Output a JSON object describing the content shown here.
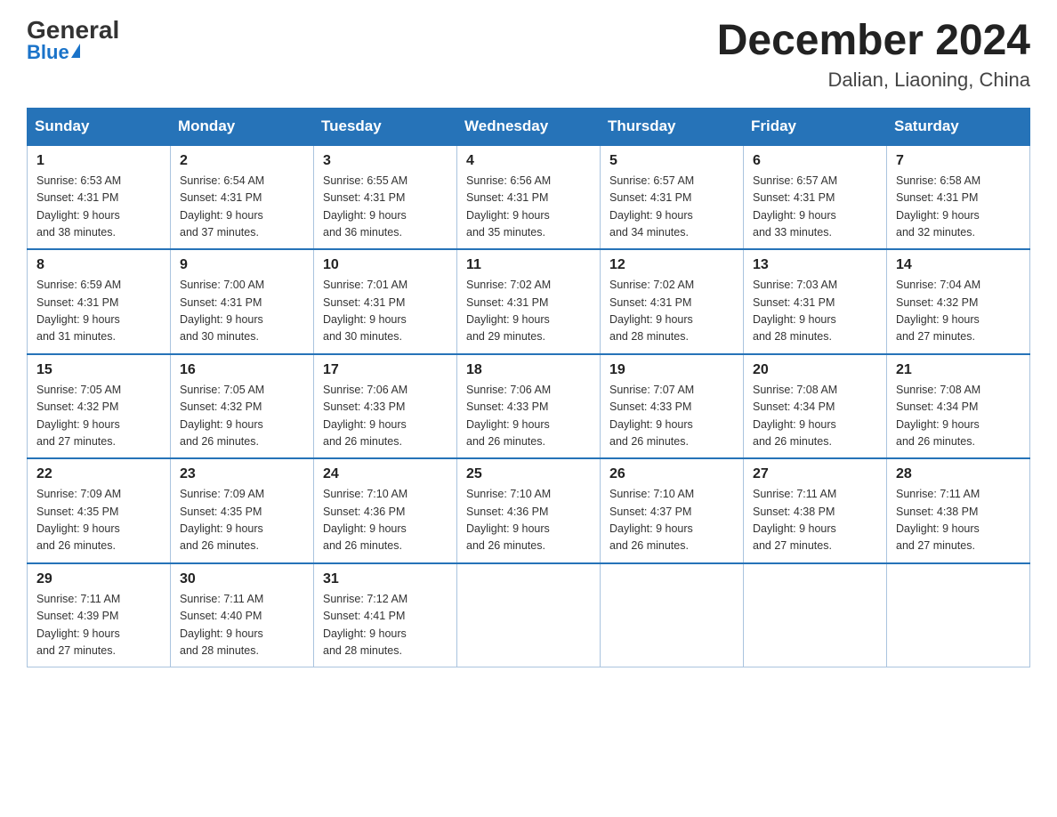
{
  "header": {
    "logo_general": "General",
    "logo_blue": "Blue",
    "month_title": "December 2024",
    "subtitle": "Dalian, Liaoning, China"
  },
  "weekdays": [
    "Sunday",
    "Monday",
    "Tuesday",
    "Wednesday",
    "Thursday",
    "Friday",
    "Saturday"
  ],
  "weeks": [
    [
      {
        "day": "1",
        "sunrise": "6:53 AM",
        "sunset": "4:31 PM",
        "daylight": "9 hours and 38 minutes."
      },
      {
        "day": "2",
        "sunrise": "6:54 AM",
        "sunset": "4:31 PM",
        "daylight": "9 hours and 37 minutes."
      },
      {
        "day": "3",
        "sunrise": "6:55 AM",
        "sunset": "4:31 PM",
        "daylight": "9 hours and 36 minutes."
      },
      {
        "day": "4",
        "sunrise": "6:56 AM",
        "sunset": "4:31 PM",
        "daylight": "9 hours and 35 minutes."
      },
      {
        "day": "5",
        "sunrise": "6:57 AM",
        "sunset": "4:31 PM",
        "daylight": "9 hours and 34 minutes."
      },
      {
        "day": "6",
        "sunrise": "6:57 AM",
        "sunset": "4:31 PM",
        "daylight": "9 hours and 33 minutes."
      },
      {
        "day": "7",
        "sunrise": "6:58 AM",
        "sunset": "4:31 PM",
        "daylight": "9 hours and 32 minutes."
      }
    ],
    [
      {
        "day": "8",
        "sunrise": "6:59 AM",
        "sunset": "4:31 PM",
        "daylight": "9 hours and 31 minutes."
      },
      {
        "day": "9",
        "sunrise": "7:00 AM",
        "sunset": "4:31 PM",
        "daylight": "9 hours and 30 minutes."
      },
      {
        "day": "10",
        "sunrise": "7:01 AM",
        "sunset": "4:31 PM",
        "daylight": "9 hours and 30 minutes."
      },
      {
        "day": "11",
        "sunrise": "7:02 AM",
        "sunset": "4:31 PM",
        "daylight": "9 hours and 29 minutes."
      },
      {
        "day": "12",
        "sunrise": "7:02 AM",
        "sunset": "4:31 PM",
        "daylight": "9 hours and 28 minutes."
      },
      {
        "day": "13",
        "sunrise": "7:03 AM",
        "sunset": "4:31 PM",
        "daylight": "9 hours and 28 minutes."
      },
      {
        "day": "14",
        "sunrise": "7:04 AM",
        "sunset": "4:32 PM",
        "daylight": "9 hours and 27 minutes."
      }
    ],
    [
      {
        "day": "15",
        "sunrise": "7:05 AM",
        "sunset": "4:32 PM",
        "daylight": "9 hours and 27 minutes."
      },
      {
        "day": "16",
        "sunrise": "7:05 AM",
        "sunset": "4:32 PM",
        "daylight": "9 hours and 26 minutes."
      },
      {
        "day": "17",
        "sunrise": "7:06 AM",
        "sunset": "4:33 PM",
        "daylight": "9 hours and 26 minutes."
      },
      {
        "day": "18",
        "sunrise": "7:06 AM",
        "sunset": "4:33 PM",
        "daylight": "9 hours and 26 minutes."
      },
      {
        "day": "19",
        "sunrise": "7:07 AM",
        "sunset": "4:33 PM",
        "daylight": "9 hours and 26 minutes."
      },
      {
        "day": "20",
        "sunrise": "7:08 AM",
        "sunset": "4:34 PM",
        "daylight": "9 hours and 26 minutes."
      },
      {
        "day": "21",
        "sunrise": "7:08 AM",
        "sunset": "4:34 PM",
        "daylight": "9 hours and 26 minutes."
      }
    ],
    [
      {
        "day": "22",
        "sunrise": "7:09 AM",
        "sunset": "4:35 PM",
        "daylight": "9 hours and 26 minutes."
      },
      {
        "day": "23",
        "sunrise": "7:09 AM",
        "sunset": "4:35 PM",
        "daylight": "9 hours and 26 minutes."
      },
      {
        "day": "24",
        "sunrise": "7:10 AM",
        "sunset": "4:36 PM",
        "daylight": "9 hours and 26 minutes."
      },
      {
        "day": "25",
        "sunrise": "7:10 AM",
        "sunset": "4:36 PM",
        "daylight": "9 hours and 26 minutes."
      },
      {
        "day": "26",
        "sunrise": "7:10 AM",
        "sunset": "4:37 PM",
        "daylight": "9 hours and 26 minutes."
      },
      {
        "day": "27",
        "sunrise": "7:11 AM",
        "sunset": "4:38 PM",
        "daylight": "9 hours and 27 minutes."
      },
      {
        "day": "28",
        "sunrise": "7:11 AM",
        "sunset": "4:38 PM",
        "daylight": "9 hours and 27 minutes."
      }
    ],
    [
      {
        "day": "29",
        "sunrise": "7:11 AM",
        "sunset": "4:39 PM",
        "daylight": "9 hours and 27 minutes."
      },
      {
        "day": "30",
        "sunrise": "7:11 AM",
        "sunset": "4:40 PM",
        "daylight": "9 hours and 28 minutes."
      },
      {
        "day": "31",
        "sunrise": "7:12 AM",
        "sunset": "4:41 PM",
        "daylight": "9 hours and 28 minutes."
      },
      null,
      null,
      null,
      null
    ]
  ],
  "labels": {
    "sunrise": "Sunrise:",
    "sunset": "Sunset:",
    "daylight": "Daylight:"
  }
}
